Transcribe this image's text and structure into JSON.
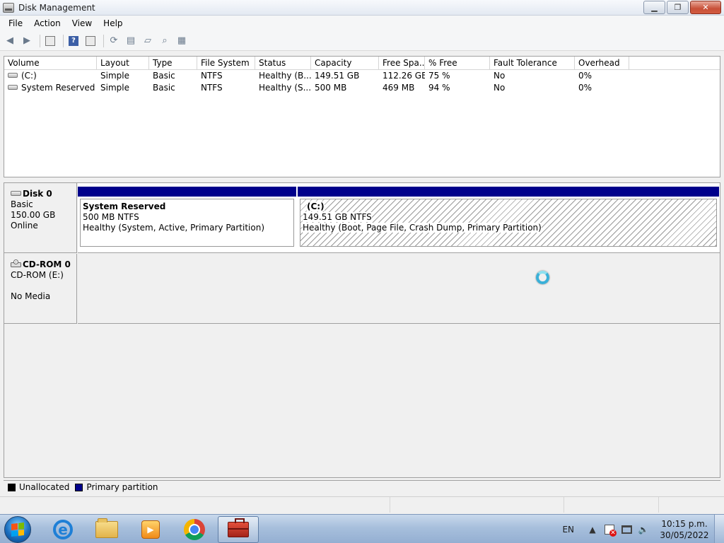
{
  "window": {
    "title": "Disk Management"
  },
  "menu": [
    "File",
    "Action",
    "View",
    "Help"
  ],
  "volume_list": {
    "columns": [
      "Volume",
      "Layout",
      "Type",
      "File System",
      "Status",
      "Capacity",
      "Free Spa...",
      "% Free",
      "Fault Tolerance",
      "Overhead"
    ],
    "rows": [
      [
        "(C:)",
        "Simple",
        "Basic",
        "NTFS",
        "Healthy (B...",
        "149.51 GB",
        "112.26 GB",
        "75 %",
        "No",
        "0%"
      ],
      [
        "System Reserved",
        "Simple",
        "Basic",
        "NTFS",
        "Healthy (S...",
        "500 MB",
        "469 MB",
        "94 %",
        "No",
        "0%"
      ]
    ]
  },
  "disks": {
    "disk0": {
      "name": "Disk 0",
      "type": "Basic",
      "size": "150.00 GB",
      "state": "Online",
      "partitions": [
        {
          "name": "System Reserved",
          "size": "500 MB NTFS",
          "status": "Healthy (System, Active, Primary Partition)"
        },
        {
          "name": "(C:)",
          "size": "149.51 GB NTFS",
          "status": "Healthy (Boot, Page File, Crash Dump, Primary Partition)"
        }
      ]
    },
    "cdrom0": {
      "name": "CD-ROM 0",
      "drive": "CD-ROM (E:)",
      "media": "No Media"
    }
  },
  "legend": {
    "unallocated": {
      "label": "Unallocated",
      "color": "#000000"
    },
    "primary": {
      "label": "Primary partition",
      "color": "#00008b"
    }
  },
  "taskbar": {
    "language": "EN",
    "time": "10:15 p.m.",
    "date": "30/05/2022"
  }
}
